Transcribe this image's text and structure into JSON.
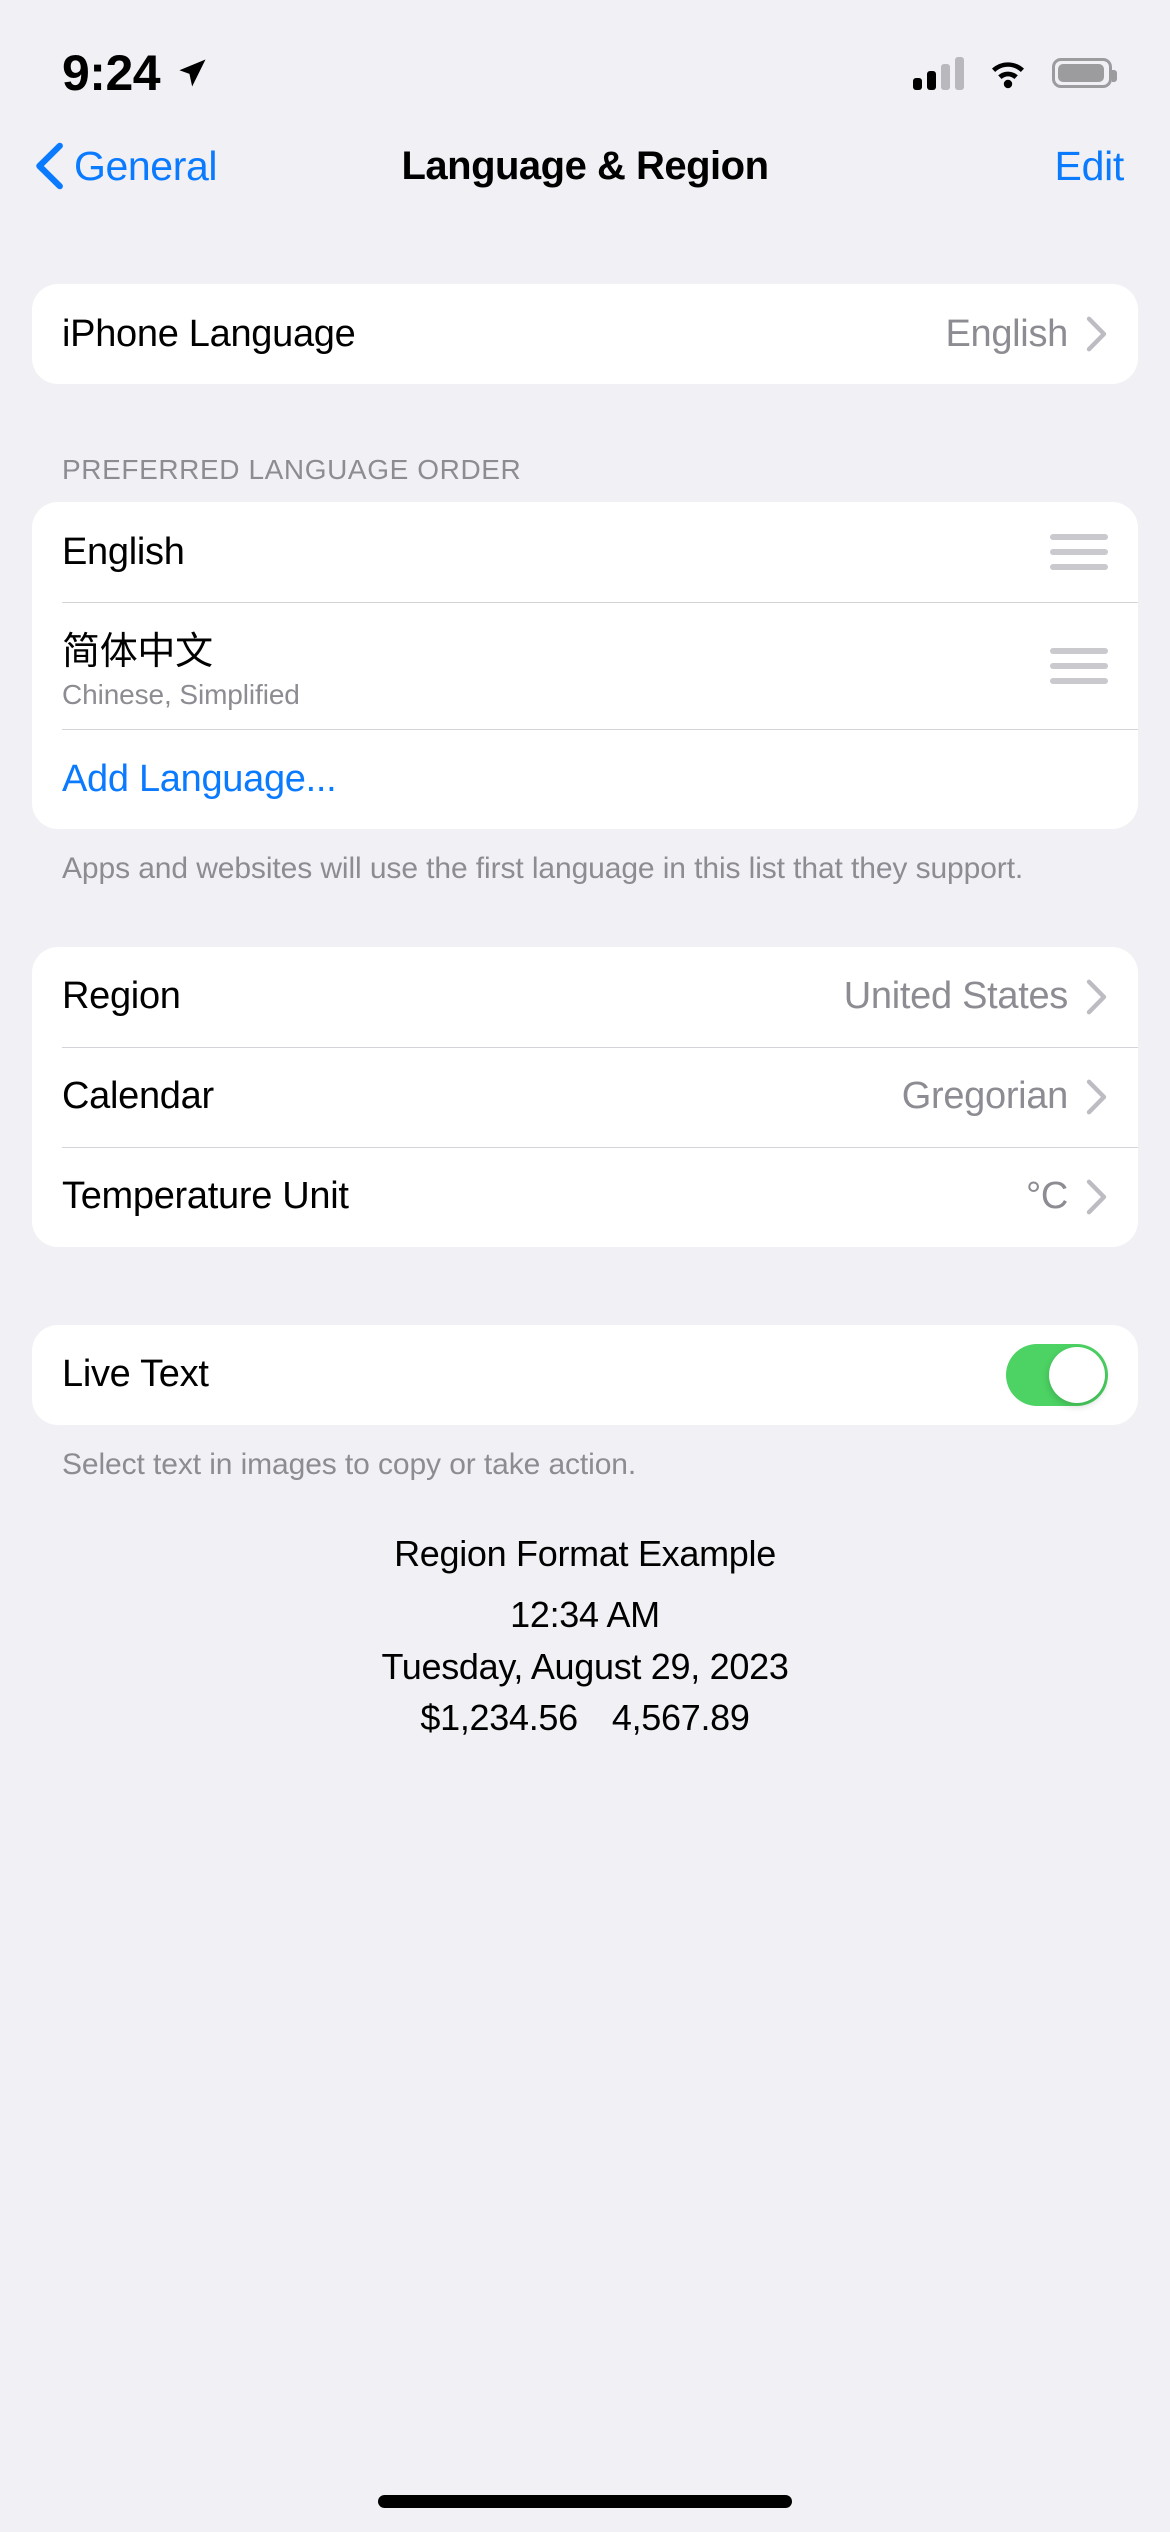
{
  "status_bar": {
    "time": "9:24",
    "location_icon": "location-arrow-icon",
    "cellular_icon": "cellular-signal-icon",
    "wifi_icon": "wifi-icon",
    "battery_icon": "battery-icon"
  },
  "nav": {
    "back_label": "General",
    "back_icon": "chevron-left-icon",
    "title": "Language & Region",
    "edit_label": "Edit"
  },
  "iphone_language": {
    "label": "iPhone Language",
    "value": "English",
    "chevron_icon": "chevron-right-icon"
  },
  "preferred_languages": {
    "header": "PREFERRED LANGUAGE ORDER",
    "items": [
      {
        "title": "English",
        "subtitle": "",
        "handle_icon": "reorder-handle-icon"
      },
      {
        "title": "简体中文",
        "subtitle": "Chinese, Simplified",
        "handle_icon": "reorder-handle-icon"
      }
    ],
    "add_label": "Add Language...",
    "footer": "Apps and websites will use the first language in this list that they support."
  },
  "region_group": {
    "rows": [
      {
        "label": "Region",
        "value": "United States",
        "chevron_icon": "chevron-right-icon"
      },
      {
        "label": "Calendar",
        "value": "Gregorian",
        "chevron_icon": "chevron-right-icon"
      },
      {
        "label": "Temperature Unit",
        "value": "°C",
        "chevron_icon": "chevron-right-icon"
      }
    ]
  },
  "live_text": {
    "label": "Live Text",
    "toggle_state": "on",
    "toggle_color": "#4cd363",
    "footer": "Select text in images to copy or take action."
  },
  "region_format_example": {
    "title": "Region Format Example",
    "time": "12:34 AM",
    "date": "Tuesday, August 29, 2023",
    "currency": "$1,234.56",
    "number": "4,567.89"
  },
  "colors": {
    "accent_blue": "#0a7aff",
    "background": "#f1f1f5",
    "card": "#ffffff",
    "secondary_text": "#8c8c92",
    "toggle_green": "#4cd363"
  }
}
